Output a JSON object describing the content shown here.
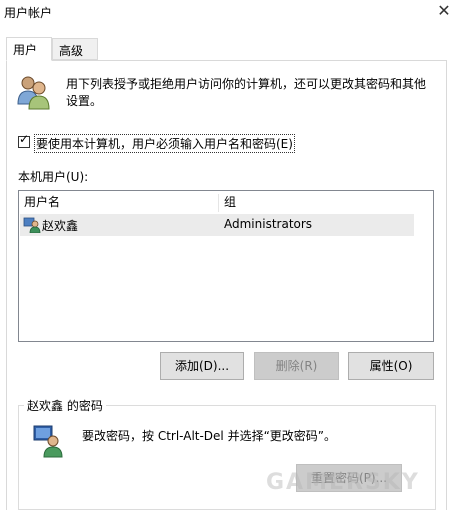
{
  "window": {
    "title": "用户帐户",
    "close_glyph": "✕"
  },
  "tabs": [
    {
      "label": "用户"
    },
    {
      "label": "高级"
    }
  ],
  "description": "用下列表授予或拒绝用户访问你的计算机，还可以更改其密码和其他设置。",
  "require_password": {
    "label": "要使用本计算机，用户必须输入用户名和密码(E)",
    "checked": true,
    "checkmark": "✓"
  },
  "user_list": {
    "label": "本机用户(U):",
    "columns": [
      "用户名",
      "组"
    ],
    "rows": [
      {
        "name": "赵欢鑫",
        "group": "Administrators"
      }
    ]
  },
  "buttons": {
    "add": "添加(D)...",
    "remove": "删除(R)",
    "properties": "属性(O)"
  },
  "password_group": {
    "title": "赵欢鑫 的密码",
    "text": "要改密码，按 Ctrl-Alt-Del 并选择“更改密码”。",
    "reset": "重置密码(P)..."
  },
  "watermark": "GAMERSKY"
}
